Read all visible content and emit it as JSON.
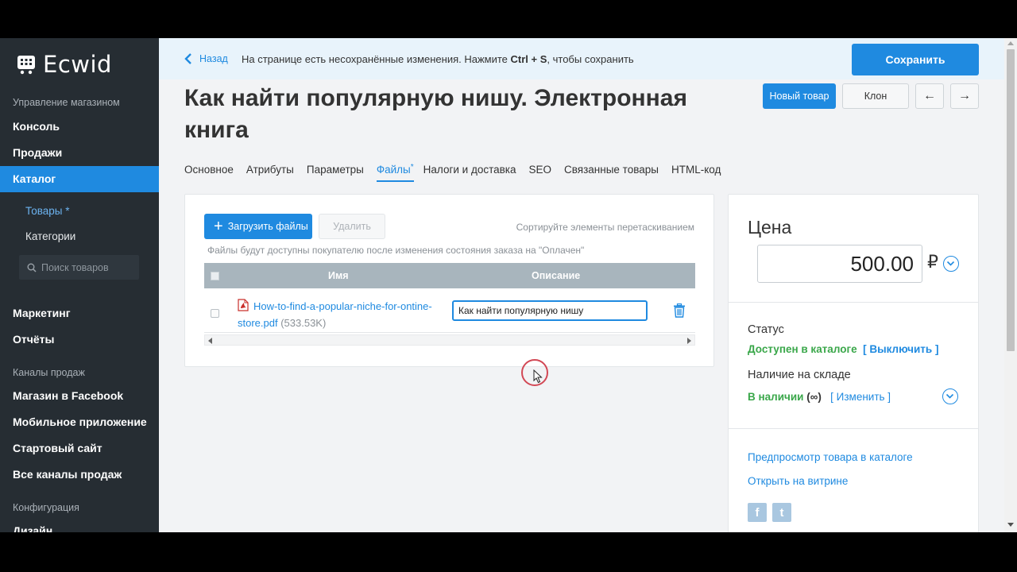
{
  "app": {
    "name": "Ecwid"
  },
  "sidebar": {
    "section_manage": "Управление магазином",
    "items_main": [
      {
        "label": "Консоль"
      },
      {
        "label": "Продажи"
      },
      {
        "label": "Каталог"
      }
    ],
    "catalog_sub": [
      {
        "label": "Товары *"
      },
      {
        "label": "Категории"
      }
    ],
    "search_placeholder": "Поиск товаров",
    "items_more": [
      {
        "label": "Маркетинг"
      },
      {
        "label": "Отчёты"
      }
    ],
    "section_channels": "Каналы продаж",
    "items_channels": [
      {
        "label": "Магазин в Facebook"
      },
      {
        "label": "Мобильное приложение"
      },
      {
        "label": "Стартовый сайт"
      },
      {
        "label": "Все каналы продаж"
      }
    ],
    "section_config": "Конфигурация",
    "item_design": "Дизайн"
  },
  "topbar": {
    "back_label": "Назад",
    "notice_pre": "На странице есть несохранённые изменения. Нажмите ",
    "notice_keys": "Ctrl + S",
    "notice_post": ", чтобы сохранить",
    "save_label": "Сохранить"
  },
  "product": {
    "title": "Как найти популярную нишу. Электронная книга",
    "new_label": "Новый товар",
    "clone_label": "Клон",
    "prev_label": "←",
    "next_label": "→"
  },
  "tabs": [
    {
      "label": "Основное"
    },
    {
      "label": "Атрибуты"
    },
    {
      "label": "Параметры"
    },
    {
      "label": "Файлы",
      "mark": "*"
    },
    {
      "label": "Налоги и доставка"
    },
    {
      "label": "SEO"
    },
    {
      "label": "Связанные товары"
    },
    {
      "label": "HTML-код"
    }
  ],
  "files": {
    "upload_label": "Загрузить файлы",
    "delete_label": "Удалить",
    "sort_hint": "Сортируйте элементы перетаскиванием",
    "availability_hint": "Файлы будут доступны покупателю после изменения состояния заказа на \"Оплачен\"",
    "columns": {
      "name": "Имя",
      "description": "Описание"
    },
    "rows": [
      {
        "file_name": "How-to-find-a-popular-niche-for-ontine-store.pdf",
        "file_size": "(533.53K)",
        "description": "Как найти популярную нишу"
      }
    ]
  },
  "pricing": {
    "title": "Цена",
    "price_value": "500.00",
    "currency": "₽",
    "status_label": "Статус",
    "status_value": "Доступен в каталоге",
    "status_action": "[ Выключить ]",
    "stock_label": "Наличие на складе",
    "stock_value": "В наличии",
    "stock_qty": "(∞)",
    "stock_action": "[ Изменить ]",
    "preview_link": "Предпросмотр товара в каталоге",
    "storefront_link": "Открыть на витрине",
    "social": {
      "facebook": "f",
      "twitter": "t"
    }
  },
  "colors": {
    "accent": "#1f8ae0",
    "sidebar_bg": "#262d33",
    "status_green": "#3aa74a"
  }
}
